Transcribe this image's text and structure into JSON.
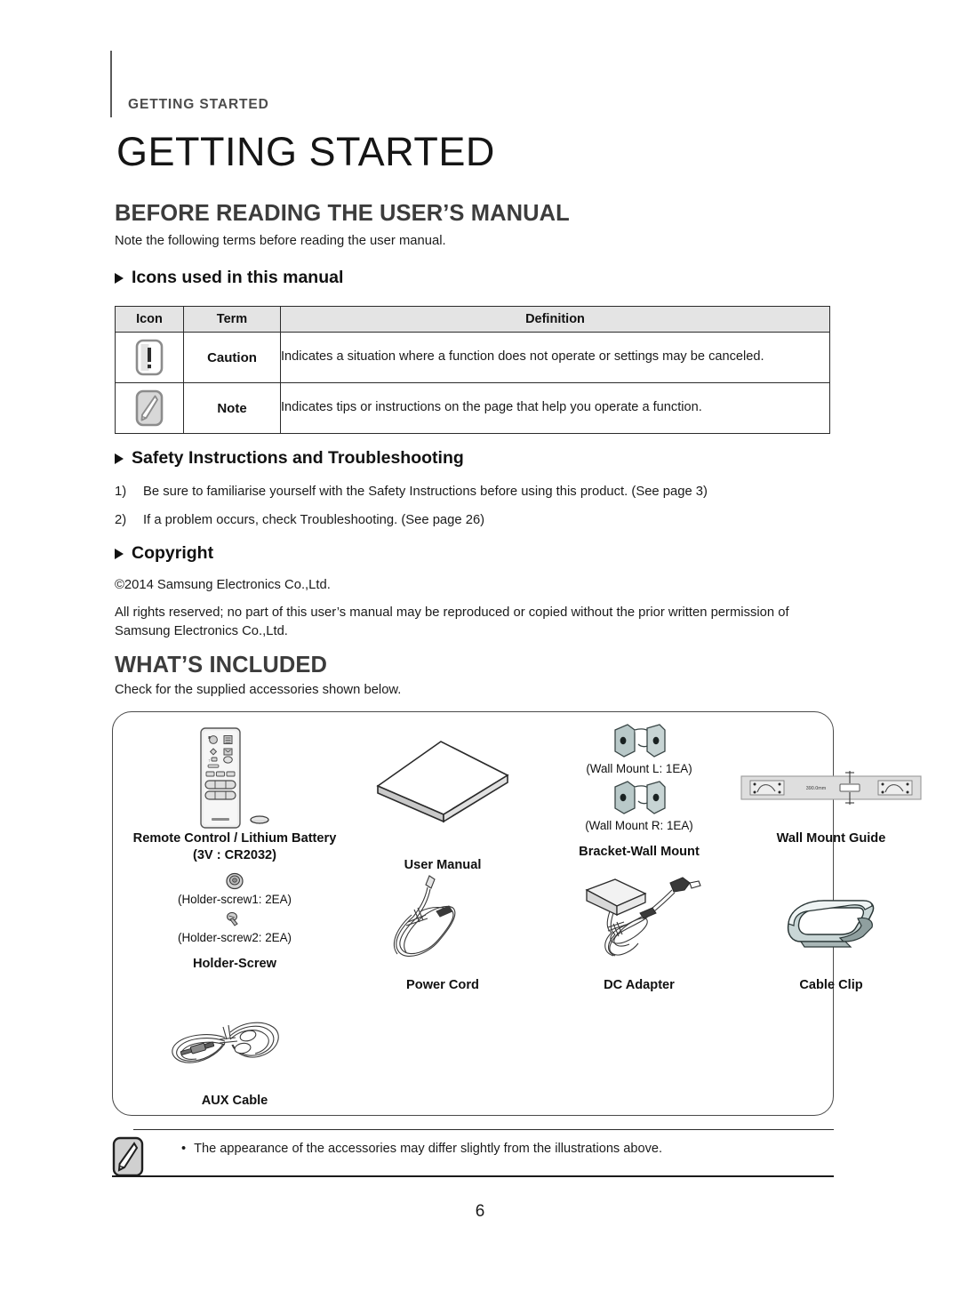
{
  "running_header": "GETTING STARTED",
  "chapter_title": "GETTING STARTED",
  "sections": {
    "before_reading": {
      "heading": "BEFORE READING THE USER’S MANUAL",
      "intro": "Note the following terms before reading the user manual.",
      "icons_subheading": "Icons used in this manual",
      "table": {
        "headers": [
          "Icon",
          "Term",
          "Definition"
        ],
        "rows": [
          {
            "icon": "caution-icon",
            "term": "Caution",
            "definition": "Indicates a situation where a function does not operate or settings may be canceled."
          },
          {
            "icon": "note-icon",
            "term": "Note",
            "definition": "Indicates tips or instructions on the page that help you operate a function."
          }
        ]
      },
      "safety_subheading": "Safety Instructions and Troubleshooting",
      "safety_items": [
        {
          "num": "1)",
          "text": "Be sure to familiarise yourself with the Safety Instructions before using this product. (See page 3)"
        },
        {
          "num": "2)",
          "text": "If a problem occurs, check Troubleshooting. (See page 26)"
        }
      ],
      "copyright_subheading": "Copyright",
      "copyright_line1": "©2014 Samsung Electronics Co.,Ltd.",
      "copyright_line2": "All rights reserved; no part of this user’s manual may be reproduced or copied without the prior written permission of Samsung Electronics Co.,Ltd."
    },
    "whats_included": {
      "heading": "WHAT’S INCLUDED",
      "intro": "Check for the supplied accessories shown below.",
      "accessories": [
        {
          "art": "remote-control",
          "caption": "Remote Control / Lithium Battery (3V : CR2032)",
          "sublabels": []
        },
        {
          "art": "user-manual",
          "caption": "User Manual",
          "sublabels": []
        },
        {
          "art": "wall-bracket",
          "caption": "Bracket-Wall Mount",
          "sublabels": [
            "(Wall Mount L: 1EA)",
            "(Wall Mount R: 1EA)"
          ]
        },
        {
          "art": "wall-mount-guide",
          "caption": "Wall Mount Guide",
          "sublabels": [],
          "guide_dimension": "390.0mm"
        },
        {
          "art": "holder-screw",
          "caption": "Holder-Screw",
          "sublabels": [
            "(Holder-screw1: 2EA)",
            "(Holder-screw2: 2EA)"
          ]
        },
        {
          "art": "power-cord",
          "caption": "Power Cord",
          "sublabels": []
        },
        {
          "art": "dc-adapter",
          "caption": "DC Adapter",
          "sublabels": []
        },
        {
          "art": "cable-clip",
          "caption": "Cable Clip",
          "sublabels": []
        },
        {
          "art": "aux-cable",
          "caption": "AUX Cable",
          "sublabels": []
        }
      ],
      "note_callout": {
        "icon": "note-icon",
        "bullet": "•",
        "text": "The appearance of the accessories may differ slightly from the illustrations above."
      }
    }
  },
  "page_number": "6",
  "colors": {
    "header_gray": "#4c4c4c",
    "heading_gray": "#3c3c3c",
    "table_header_bg": "#e4e4e4",
    "rule": "#2a2a2a",
    "metal_blue": "#b9c9c9"
  }
}
